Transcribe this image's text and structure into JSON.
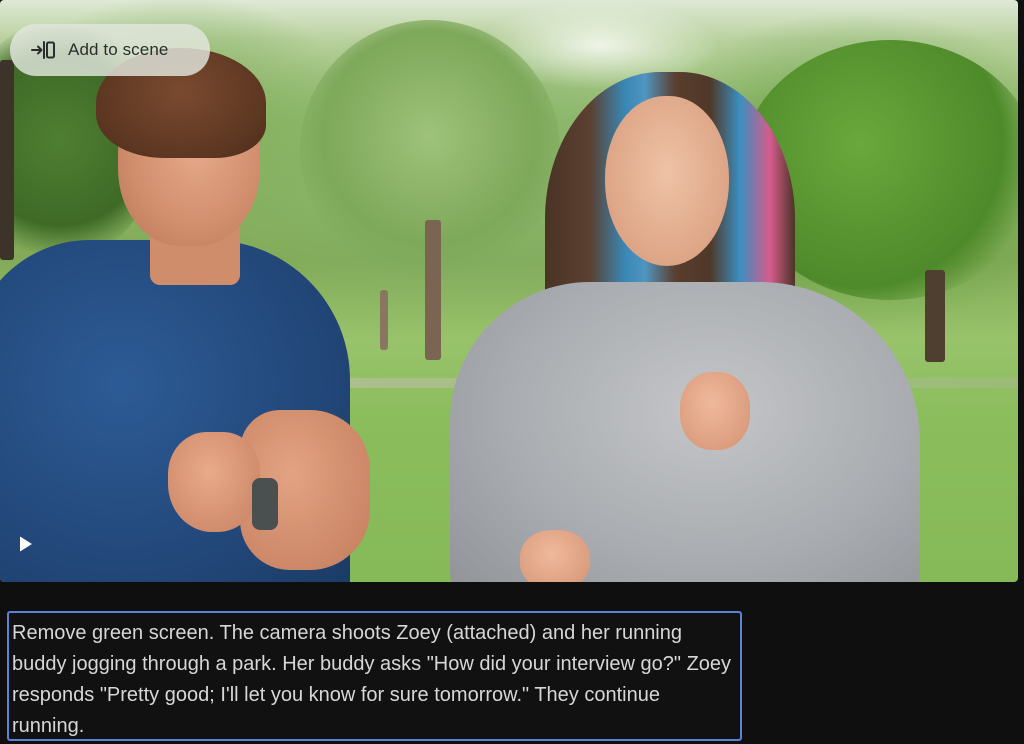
{
  "video": {
    "add_to_scene_label": "Add to scene",
    "add_to_scene_icon": "insert-into-scene-icon",
    "play_icon": "play-icon"
  },
  "prompt": {
    "text": "Remove green screen. The camera shoots Zoey (attached) and her running buddy jogging through a park. Her buddy asks \"How did your interview go?\" Zoey responds \"Pretty good; I'll let you know for sure tomorrow.\" They continue running."
  },
  "colors": {
    "background": "#0f0f10",
    "prompt_border": "#5b83d6",
    "prompt_text": "#d7d7d7",
    "button_bg": "#e2e6de"
  }
}
